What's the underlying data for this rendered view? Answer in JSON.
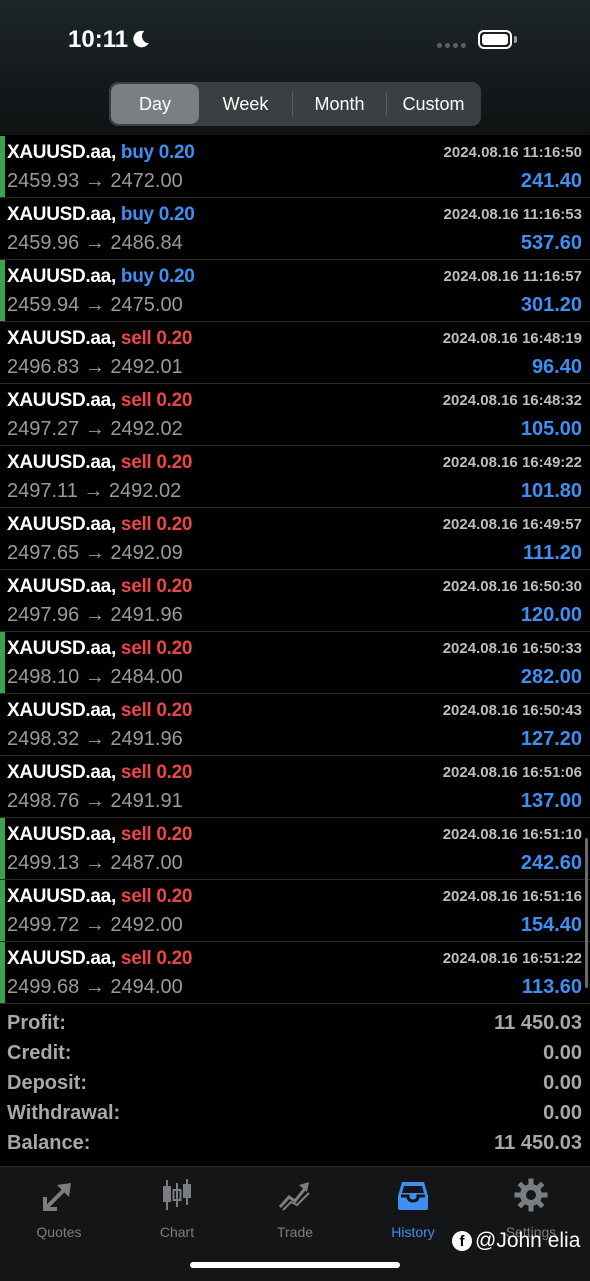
{
  "status": {
    "time": "10:11"
  },
  "segments": [
    {
      "label": "Day",
      "active": true
    },
    {
      "label": "Week",
      "active": false
    },
    {
      "label": "Month",
      "active": false
    },
    {
      "label": "Custom",
      "active": false
    }
  ],
  "deals": [
    {
      "symbol": "XAUUSD.aa,",
      "type": "buy 0.20",
      "side": "buy",
      "prices": "2459.93 → 2472.00",
      "time": "2024.08.16 11:16:50",
      "profit": "241.40",
      "marker": true
    },
    {
      "symbol": "XAUUSD.aa,",
      "type": "buy 0.20",
      "side": "buy",
      "prices": "2459.96 → 2486.84",
      "time": "2024.08.16 11:16:53",
      "profit": "537.60",
      "marker": false
    },
    {
      "symbol": "XAUUSD.aa,",
      "type": "buy 0.20",
      "side": "buy",
      "prices": "2459.94 → 2475.00",
      "time": "2024.08.16 11:16:57",
      "profit": "301.20",
      "marker": true
    },
    {
      "symbol": "XAUUSD.aa,",
      "type": "sell 0.20",
      "side": "sell",
      "prices": "2496.83 → 2492.01",
      "time": "2024.08.16 16:48:19",
      "profit": "96.40",
      "marker": false
    },
    {
      "symbol": "XAUUSD.aa,",
      "type": "sell 0.20",
      "side": "sell",
      "prices": "2497.27 → 2492.02",
      "time": "2024.08.16 16:48:32",
      "profit": "105.00",
      "marker": false
    },
    {
      "symbol": "XAUUSD.aa,",
      "type": "sell 0.20",
      "side": "sell",
      "prices": "2497.11 → 2492.02",
      "time": "2024.08.16 16:49:22",
      "profit": "101.80",
      "marker": false
    },
    {
      "symbol": "XAUUSD.aa,",
      "type": "sell 0.20",
      "side": "sell",
      "prices": "2497.65 → 2492.09",
      "time": "2024.08.16 16:49:57",
      "profit": "111.20",
      "marker": false
    },
    {
      "symbol": "XAUUSD.aa,",
      "type": "sell 0.20",
      "side": "sell",
      "prices": "2497.96 → 2491.96",
      "time": "2024.08.16 16:50:30",
      "profit": "120.00",
      "marker": false
    },
    {
      "symbol": "XAUUSD.aa,",
      "type": "sell 0.20",
      "side": "sell",
      "prices": "2498.10 → 2484.00",
      "time": "2024.08.16 16:50:33",
      "profit": "282.00",
      "marker": true
    },
    {
      "symbol": "XAUUSD.aa,",
      "type": "sell 0.20",
      "side": "sell",
      "prices": "2498.32 → 2491.96",
      "time": "2024.08.16 16:50:43",
      "profit": "127.20",
      "marker": false
    },
    {
      "symbol": "XAUUSD.aa,",
      "type": "sell 0.20",
      "side": "sell",
      "prices": "2498.76 → 2491.91",
      "time": "2024.08.16 16:51:06",
      "profit": "137.00",
      "marker": false
    },
    {
      "symbol": "XAUUSD.aa,",
      "type": "sell 0.20",
      "side": "sell",
      "prices": "2499.13 → 2487.00",
      "time": "2024.08.16 16:51:10",
      "profit": "242.60",
      "marker": true
    },
    {
      "symbol": "XAUUSD.aa,",
      "type": "sell 0.20",
      "side": "sell",
      "prices": "2499.72 → 2492.00",
      "time": "2024.08.16 16:51:16",
      "profit": "154.40",
      "marker": true
    },
    {
      "symbol": "XAUUSD.aa,",
      "type": "sell 0.20",
      "side": "sell",
      "prices": "2499.68 → 2494.00",
      "time": "2024.08.16 16:51:22",
      "profit": "113.60",
      "marker": true
    }
  ],
  "summary": [
    {
      "label": "Profit:",
      "value": "11 450.03"
    },
    {
      "label": "Credit:",
      "value": "0.00"
    },
    {
      "label": "Deposit:",
      "value": "0.00"
    },
    {
      "label": "Withdrawal:",
      "value": "0.00"
    },
    {
      "label": "Balance:",
      "value": "11 450.03"
    }
  ],
  "tabs": [
    {
      "label": "Quotes",
      "icon": "quotes-icon",
      "active": false
    },
    {
      "label": "Chart",
      "icon": "chart-icon",
      "active": false
    },
    {
      "label": "Trade",
      "icon": "trade-icon",
      "active": false
    },
    {
      "label": "History",
      "icon": "history-icon",
      "active": true
    },
    {
      "label": "Settings",
      "icon": "settings-icon",
      "active": false
    }
  ],
  "watermark": {
    "icon": "facebook-icon",
    "text": "@John elia"
  },
  "colors": {
    "buy": "#3f8ef2",
    "sell": "#ec4548",
    "profit": "#3f8ef2",
    "marker": "#3ba34a",
    "active_tab": "#3f8ef2"
  }
}
